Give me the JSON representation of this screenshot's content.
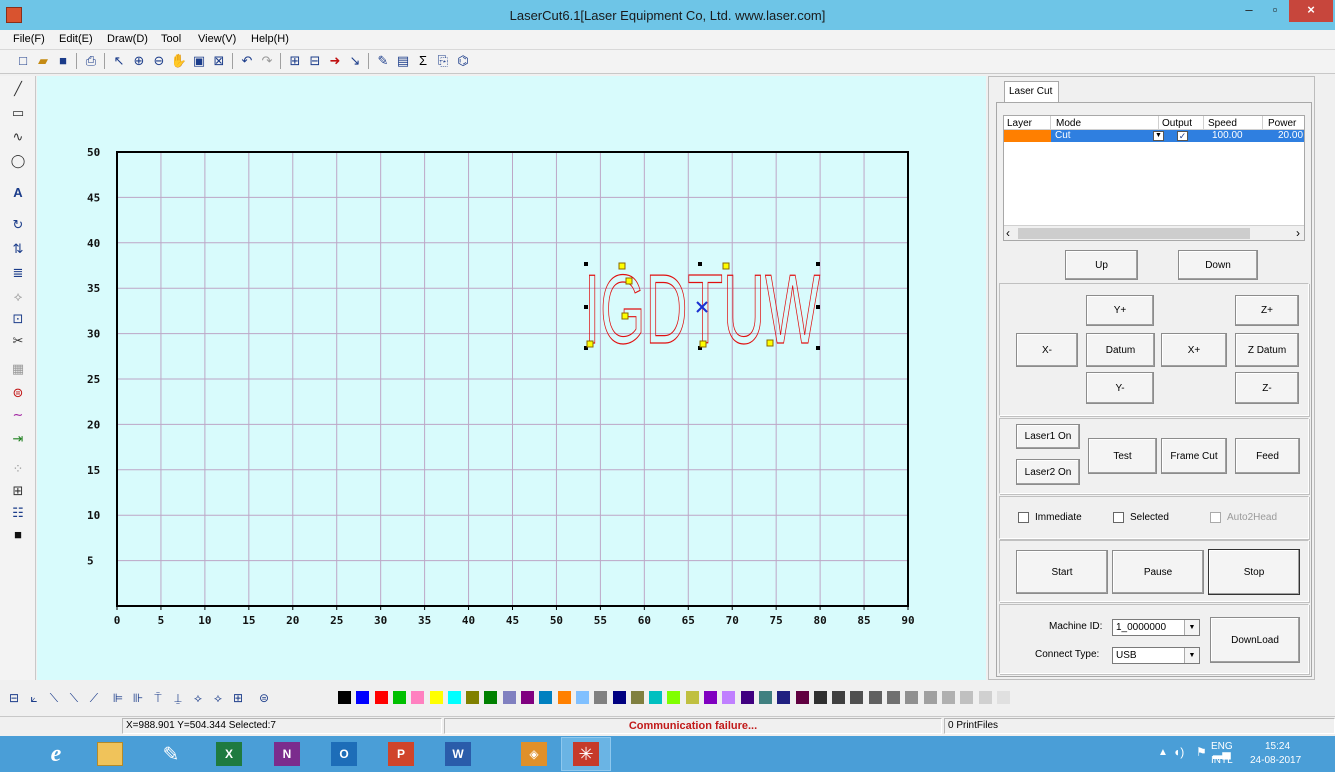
{
  "window": {
    "title": "LaserCut6.1[Laser Equipment Co, Ltd. www.laser.com]",
    "min_glyph": "–",
    "max_glyph": "▫",
    "close_glyph": "×"
  },
  "menu": [
    "File(F)",
    "Edit(E)",
    "Draw(D)",
    "Tool",
    "View(V)",
    "Help(H)"
  ],
  "toolbar_icons": [
    "new-file-icon",
    "open-folder-icon",
    "save-icon",
    "print-icon",
    "select-pointer-icon",
    "zoom-in-icon",
    "zoom-out-icon",
    "pan-hand-icon",
    "zoom-fit-icon",
    "zoom-page-icon",
    "undo-icon",
    "redo-icon",
    "group-icon",
    "ungroup-icon",
    "path-direction-icon",
    "start-point-icon",
    "properties-icon",
    "settings-panel-icon",
    "sum-icon",
    "preview-icon",
    "simulate-icon"
  ],
  "left_tools": [
    "line-icon",
    "rectangle-icon",
    "curve-icon",
    "ellipse-icon",
    "text-icon",
    "rotate-icon",
    "mirror-icon",
    "align-icon",
    "node-edit-icon",
    "array-icon",
    "scissors-icon",
    "fill-icon",
    "measure-icon",
    "smooth-icon",
    "join-icon",
    "dots-icon",
    "grid-array-icon",
    "sort-icon",
    "block-icon"
  ],
  "canvas": {
    "x_ticks": [
      "0",
      "5",
      "10",
      "15",
      "20",
      "25",
      "30",
      "35",
      "40",
      "45",
      "50",
      "55",
      "60",
      "65",
      "70",
      "75",
      "80",
      "85",
      "90"
    ],
    "y_ticks": [
      "5",
      "10",
      "15",
      "20",
      "25",
      "30",
      "35",
      "40",
      "45",
      "50"
    ],
    "text_object": "IGDTUW",
    "text_color": "#e01010"
  },
  "panel": {
    "tab_label": "Laser Cut",
    "table_headers": [
      "Layer",
      "Mode",
      "Output",
      "Speed",
      "Power"
    ],
    "layer": {
      "color": "#ff7f00",
      "mode": "Cut",
      "output_checked": true,
      "speed": "100.00",
      "power": "20.00"
    },
    "up_label": "Up",
    "down_label": "Down",
    "yplus": "Y+",
    "yminus": "Y-",
    "xminus": "X-",
    "xplus": "X+",
    "datum": "Datum",
    "zplus": "Z+",
    "zminus": "Z-",
    "zdatum": "Z Datum",
    "laser1": "Laser1 On",
    "laser2": "Laser2 On",
    "test": "Test",
    "framecut": "Frame Cut",
    "feed": "Feed",
    "immediate": "Immediate",
    "selected": "Selected",
    "auto2head": "Auto2Head",
    "start": "Start",
    "pause": "Pause",
    "stop": "Stop",
    "machine_id_label": "Machine ID:",
    "machine_id_value": "1_0000000",
    "connect_type_label": "Connect Type:",
    "connect_type_value": "USB",
    "download": "DownLoad"
  },
  "palette_colors": [
    "#000000",
    "#0000ff",
    "#ff0000",
    "#00c000",
    "#ff80c0",
    "#ffff00",
    "#00ffff",
    "#808000",
    "#008000",
    "#8080c0",
    "#800080",
    "#0080c0",
    "#ff8000",
    "#80c0ff",
    "#808080",
    "#000080",
    "#808040",
    "#00c0c0",
    "#80ff00",
    "#c0c040",
    "#8000c0",
    "#c080ff",
    "#400080",
    "#408080",
    "#202080",
    "#600040",
    "#303030",
    "#404040",
    "#505050",
    "#606060",
    "#707070",
    "#909090",
    "#a0a0a0",
    "#b0b0b0",
    "#c0c0c0",
    "#d0d0d0",
    "#e0e0e0"
  ],
  "status": {
    "coords": "X=988.901 Y=504.344 Selected:7",
    "message": "Communication failure...",
    "printfiles": "0 PrintFiles"
  },
  "taskbar": {
    "apps": [
      "ie-icon",
      "explorer-icon",
      "tool-icon",
      "excel-icon",
      "onenote-icon",
      "outlook-icon",
      "powerpoint-icon",
      "word-icon",
      "paint-icon",
      "lasercut-icon"
    ],
    "lang_top": "ENG",
    "lang_bottom": "INTL",
    "time": "15:24",
    "date": "24-08-2017"
  }
}
